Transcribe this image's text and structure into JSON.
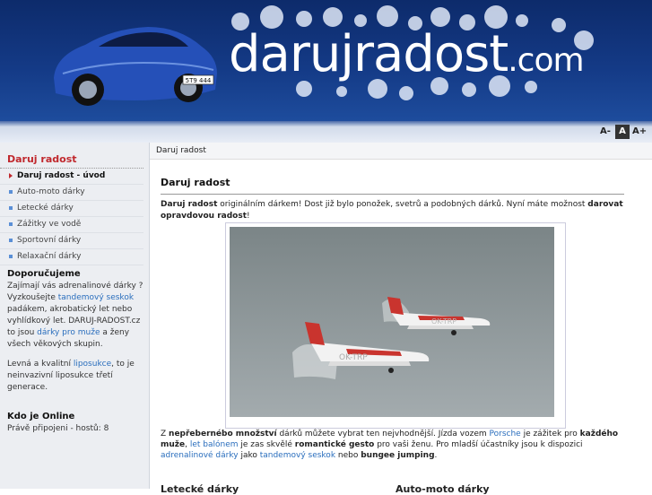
{
  "header": {
    "logo_main": "darujradost",
    "logo_tld": ".com",
    "car_plate": "5T9 444"
  },
  "font_controls": [
    "A-",
    "A",
    "A+"
  ],
  "sidebar": {
    "title": "Daruj radost",
    "items": [
      {
        "label": "Daruj radost - úvod",
        "current": true
      },
      {
        "label": "Auto-moto dárky"
      },
      {
        "label": "Letecké dárky"
      },
      {
        "label": "Zážitky ve vodě"
      },
      {
        "label": "Sportovní dárky"
      },
      {
        "label": "Relaxační dárky"
      }
    ],
    "recommend": {
      "heading": "Doporučujeme",
      "p1_a": "Zajímají vás adrenalinové dárky ? Vyzkoušejte ",
      "p1_link1": "tandemový seskok",
      "p1_b": " padákem, akrobatický let nebo vyhlídkový let. DARUJ-RADOST.cz to jsou ",
      "p1_link2": "dárky pro muže",
      "p1_c": " a ženy všech věkových skupin.",
      "p2_a": "Levná a kvalitní ",
      "p2_link": "liposukce",
      "p2_b": ", to je neinvazivní liposukce třetí generace."
    },
    "online": {
      "heading": "Kdo je Online",
      "text": "Právě připojeni - hostů: 8"
    }
  },
  "breadcrumb": "Daruj radost",
  "main": {
    "title": "Daruj radost",
    "intro_b1": "Daruj radost",
    "intro_t1": " originálním dárkem! Dost již bylo ponožek, svetrů a podobných dárků. Nyní máte možnost ",
    "intro_b2": "darovat opravdovou radost",
    "intro_t2": "!",
    "photo_reg": "OK-TRP",
    "para": {
      "t1": "Z ",
      "b1": "nepřebernébo množství",
      "t2": " dárků můžete vybrat ten nejvhodnější. Jízda vozem ",
      "l1": "Porsche",
      "t3": " je zážitek pro ",
      "b2": "každého muže",
      "t4": ", ",
      "l2": "let balónem",
      "t5": " je zas skvělé ",
      "b3": "romantické gesto",
      "t6": " pro vaši ženu. Pro mladší účastníky jsou k dispozici ",
      "l3": "adrenalinové dárky",
      "t7": " jako ",
      "l4": "tandemový seskok",
      "t8": " nebo ",
      "b4": "bungee jumping",
      "t9": "."
    },
    "partial_left": "Letecké dárky",
    "partial_right": "Auto-moto dárky"
  },
  "colors": {
    "header_blue": "#143a86",
    "accent_red": "#c0282d",
    "link_blue": "#2a6ebd"
  }
}
